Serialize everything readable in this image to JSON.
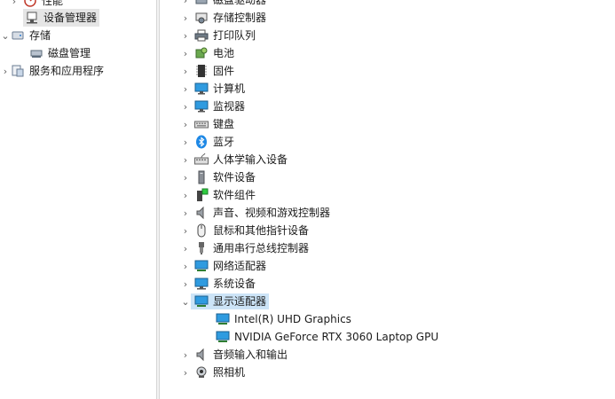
{
  "left_tree": {
    "performance": "性能",
    "device_manager": "设备管理器",
    "storage": "存储",
    "disk_management": "磁盘管理",
    "services_apps": "服务和应用程序"
  },
  "device_tree": {
    "categories": [
      "磁盘驱动器",
      "存储控制器",
      "打印队列",
      "电池",
      "固件",
      "计算机",
      "监视器",
      "键盘",
      "蓝牙",
      "人体学输入设备",
      "软件设备",
      "软件组件",
      "声音、视频和游戏控制器",
      "鼠标和其他指针设备",
      "通用串行总线控制器",
      "网络适配器",
      "系统设备",
      "显示适配器"
    ],
    "display_adapters": [
      "Intel(R) UHD Graphics",
      "NVIDIA GeForce RTX 3060 Laptop GPU"
    ],
    "after": [
      "音频输入和输出",
      "照相机"
    ]
  },
  "colors": {
    "selection": "#cce4f7",
    "accent": "#0078d4"
  }
}
